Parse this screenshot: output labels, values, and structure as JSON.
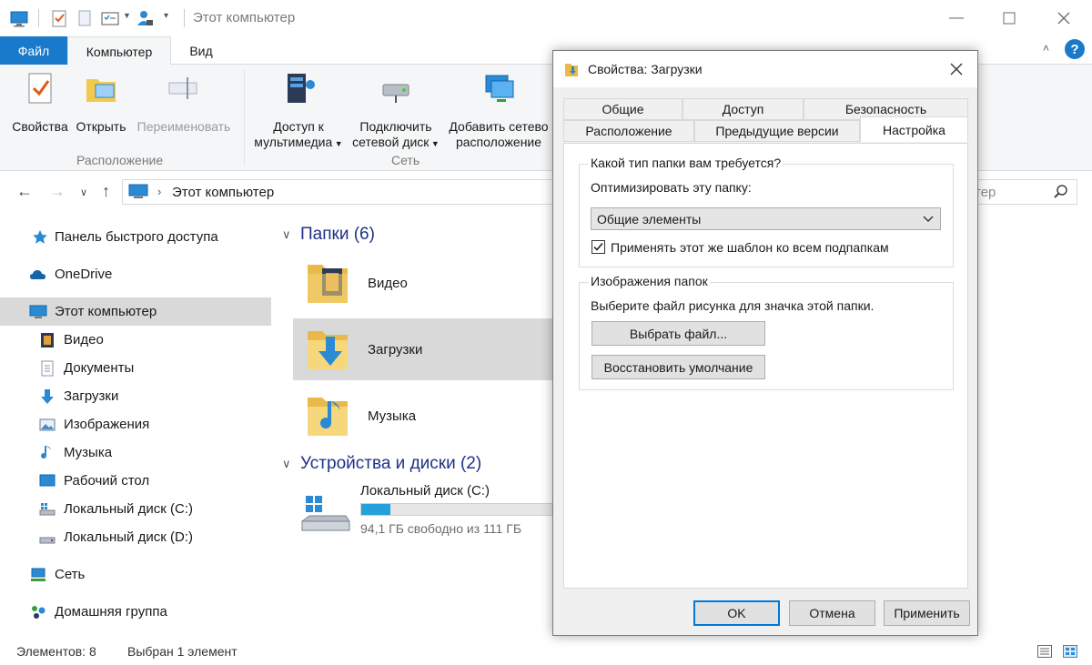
{
  "window": {
    "title": "Этот компьютер",
    "minimize_icon": "minimize-icon",
    "maximize_icon": "maximize-icon",
    "close_icon": "close-icon"
  },
  "ribbon_tabs": {
    "file": "Файл",
    "computer": "Компьютер",
    "view": "Вид"
  },
  "ribbon": {
    "properties": "Свойства",
    "open": "Открыть",
    "rename": "Переименовать",
    "media_access": [
      "Доступ к",
      "мультимедиа"
    ],
    "map_drive": [
      "Подключить",
      "сетевой диск"
    ],
    "add_location": [
      "Добавить сетево",
      "расположение"
    ],
    "group_location": "Расположение",
    "group_network": "Сеть"
  },
  "address": {
    "path": "Этот компьютер",
    "search_placeholder": "тер"
  },
  "sidebar": {
    "quick_access": "Панель быстрого доступа",
    "onedrive": "OneDrive",
    "this_pc": "Этот компьютер",
    "items": [
      "Видео",
      "Документы",
      "Загрузки",
      "Изображения",
      "Музыка",
      "Рабочий стол",
      "Локальный диск (C:)",
      "Локальный диск (D:)"
    ],
    "network": "Сеть",
    "homegroup": "Домашняя группа"
  },
  "content": {
    "folders_header": "Папки (6)",
    "folders": [
      "Видео",
      "Загрузки",
      "Музыка"
    ],
    "devices_header": "Устройства и диски (2)",
    "drive": {
      "name": "Локальный диск (C:)",
      "free_text": "94,1 ГБ свободно из 111 ГБ",
      "used_fraction": 0.15
    }
  },
  "status": {
    "items_count": "Элементов: 8",
    "selected": "Выбран 1 элемент"
  },
  "dialog": {
    "title": "Свойства: Загрузки",
    "tabs_row1": [
      "Общие",
      "Доступ",
      "Безопасность"
    ],
    "tabs_row2": [
      "Расположение",
      "Предыдущие версии",
      "Настройка"
    ],
    "active_tab": "Настройка",
    "section1_legend": "Какой тип папки вам требуется?",
    "optimize_label": "Оптимизировать эту папку:",
    "optimize_value": "Общие элементы",
    "apply_template_label": "Применять этот же шаблон ко всем подпапкам",
    "apply_template_checked": true,
    "section2_legend": "Изображения папок",
    "choose_image_label": "Выберите файл рисунка для значка этой папки.",
    "choose_file_button": "Выбрать файл...",
    "restore_default_button": "Восстановить умолчание",
    "ok_button": "OK",
    "cancel_button": "Отмена",
    "apply_button": "Применить"
  },
  "colors": {
    "accent": "#1979ca",
    "selection": "#d9d9d9",
    "group_header": "#1e3287",
    "drive_bar": "#26a0da"
  }
}
